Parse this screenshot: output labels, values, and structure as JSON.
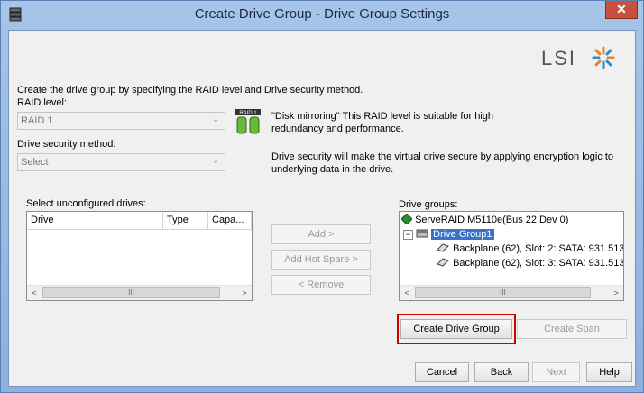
{
  "window": {
    "title": "Create Drive Group - Drive Group Settings",
    "close_glyph": "✕"
  },
  "logo": {
    "text": "LSI"
  },
  "intro": "Create the drive group by specifying the RAID level and Drive security method.",
  "raid": {
    "label": "RAID level:",
    "value": "RAID 1",
    "badge": "RAID 1",
    "description_line1": "\"Disk mirroring\" This RAID level is suitable for high",
    "description_line2": "redundancy and performance."
  },
  "security": {
    "label": "Drive security method:",
    "value": "Select",
    "description_line1": "Drive security will make the virtual drive secure by applying encryption logic to",
    "description_line2": "underlying data in the drive."
  },
  "unconfigured": {
    "label": "Select unconfigured drives:",
    "columns": [
      "Drive",
      "Type",
      "Capa..."
    ]
  },
  "middle_buttons": {
    "add": "Add >",
    "add_hot_spare": "Add Hot Spare >",
    "remove": "< Remove"
  },
  "drive_groups": {
    "label": "Drive groups:",
    "controller": "ServeRAID M5110e(Bus 22,Dev 0)",
    "group": "Drive Group1",
    "drives": [
      "Backplane (62), Slot: 2: SATA: 931.513",
      "Backplane (62), Slot: 3: SATA: 931.513"
    ]
  },
  "actions": {
    "create_drive_group": "Create Drive Group",
    "create_span": "Create Span"
  },
  "footer": {
    "cancel": "Cancel",
    "back": "Back",
    "next": "Next",
    "help": "Help"
  },
  "scroll": {
    "thumb_glyph": "III",
    "left": "<",
    "right": ">"
  },
  "combo_arrow": "⌄"
}
